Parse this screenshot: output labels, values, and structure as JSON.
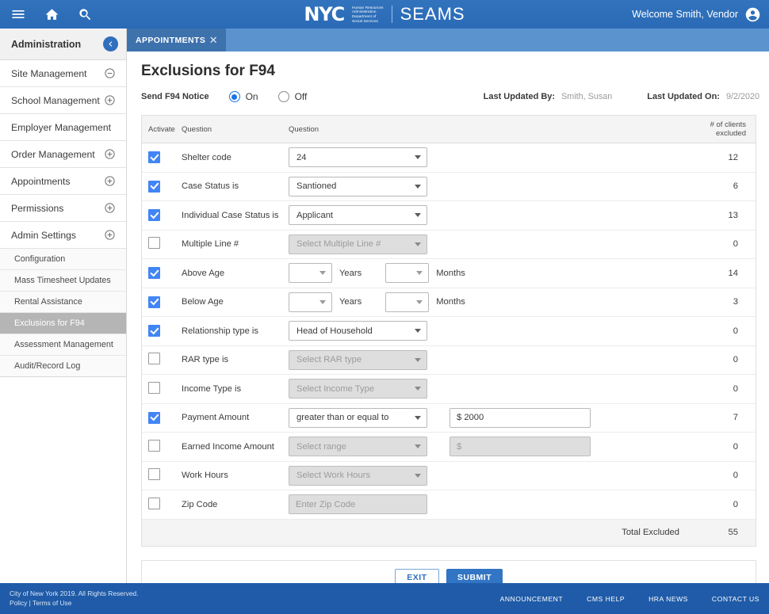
{
  "topbar": {
    "menu_icon": "hamburger-menu-icon",
    "home_icon": "home-icon",
    "search_icon": "search-icon",
    "logo_nyc": "NYC",
    "logo_agency_lines": [
      "Human Resources",
      "Administration",
      "Department of",
      "Social Services"
    ],
    "app_name": "SEAMS",
    "welcome_text": "Welcome Smith, Vendor",
    "avatar_icon": "account-circle-icon",
    "bg_color": "#2f6fbd"
  },
  "tabs": [
    {
      "label": "APPOINTMENTS",
      "close_label": "✕",
      "active": true
    }
  ],
  "sidebar": {
    "title": "Administration",
    "collapse_icon": "chevron-left-icon",
    "items": [
      {
        "label": "Site Management",
        "toggle": "minus"
      },
      {
        "label": "School Management",
        "toggle": "plus"
      },
      {
        "label": "Employer Management",
        "toggle": "none"
      },
      {
        "label": "Order Management",
        "toggle": "plus"
      },
      {
        "label": "Appointments",
        "toggle": "plus"
      },
      {
        "label": "Permissions",
        "toggle": "plus"
      },
      {
        "label": "Admin Settings",
        "toggle": "plus"
      }
    ],
    "subitems": [
      {
        "label": "Configuration",
        "active": false
      },
      {
        "label": "Mass Timesheet Updates",
        "active": false
      },
      {
        "label": "Rental Assistance",
        "active": false
      },
      {
        "label": "Exclusions for F94",
        "active": true
      },
      {
        "label": "Assessment Management",
        "active": false
      },
      {
        "label": "Audit/Record Log",
        "active": false
      }
    ]
  },
  "page": {
    "title": "Exclusions for F94",
    "notice_label": "Send F94 Notice",
    "radio_on_label": "On",
    "radio_off_label": "Off",
    "radio_selected": "On",
    "last_updated_by_label": "Last Updated By:",
    "last_updated_by_value": "Smith, Susan",
    "last_updated_on_label": "Last Updated On:",
    "last_updated_on_value": "9/2/2020"
  },
  "table": {
    "headers": [
      "Activate",
      "Question",
      "Question",
      "# of clients excluded"
    ],
    "rows": [
      {
        "checked": true,
        "question": "Shelter code",
        "control": "select",
        "value": "24",
        "disabled": false,
        "count": "12"
      },
      {
        "checked": true,
        "question": "Case Status is",
        "control": "select",
        "value": "Santioned",
        "disabled": false,
        "count": "6"
      },
      {
        "checked": true,
        "question": "Individual Case Status is",
        "control": "select",
        "value": "Applicant",
        "disabled": false,
        "count": "13"
      },
      {
        "checked": false,
        "question": "Multiple Line #",
        "control": "select",
        "value": "Select Multiple Line #",
        "disabled": true,
        "count": "0"
      },
      {
        "checked": true,
        "question": "Above Age",
        "control": "age",
        "value": "",
        "disabled": false,
        "count": "14",
        "unit1": "Years",
        "unit2": "Months"
      },
      {
        "checked": true,
        "question": "Below Age",
        "control": "age",
        "value": "",
        "disabled": false,
        "count": "3",
        "unit1": "Years",
        "unit2": "Months"
      },
      {
        "checked": true,
        "question": "Relationship type is",
        "control": "select",
        "value": "Head of Household",
        "disabled": false,
        "count": "0"
      },
      {
        "checked": false,
        "question": "RAR type is",
        "control": "select",
        "value": "Select RAR type",
        "disabled": true,
        "count": "0"
      },
      {
        "checked": false,
        "question": "Income Type is",
        "control": "select",
        "value": "Select Income Type",
        "disabled": true,
        "count": "0"
      },
      {
        "checked": true,
        "question": "Payment Amount",
        "control": "select_money",
        "value": "greater than or equal to",
        "money": "$ 2000",
        "disabled": false,
        "count": "7"
      },
      {
        "checked": false,
        "question": "Earned Income Amount",
        "control": "select_money",
        "value": "Select range",
        "money": "$",
        "disabled": true,
        "count": "0"
      },
      {
        "checked": false,
        "question": "Work Hours",
        "control": "select",
        "value": "Select Work Hours",
        "disabled": true,
        "count": "0"
      },
      {
        "checked": false,
        "question": "Zip Code",
        "control": "text",
        "value": "Enter Zip Code",
        "disabled": true,
        "count": "0"
      }
    ],
    "total_label": "Total Excluded",
    "total_value": "55"
  },
  "actions": {
    "exit_label": "EXIT",
    "submit_label": "SUBMIT"
  },
  "footer": {
    "copyright": "City of New York 2019. All Rights Reserved.",
    "policy_label": "Policy",
    "separator": "|",
    "terms_label": "Terms of Use",
    "links": [
      "ANNOUNCEMENT",
      "CMS HELP",
      "HRA NEWS",
      "CONTACT US"
    ],
    "bg_color": "#1f5ba8"
  }
}
